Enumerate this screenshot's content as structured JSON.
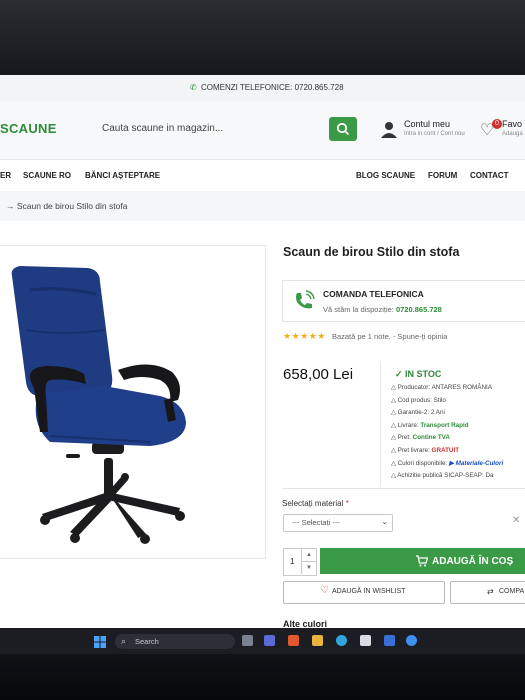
{
  "topbar": {
    "phone_text": "COMENZI TELEFONICE: 0720.865.728"
  },
  "header": {
    "logo": "SCAUNE",
    "search_placeholder": "Cauta scaune in magazin...",
    "account_label": "Contul meu",
    "account_sub": "Intra in cont / Cont nou",
    "fav_label": "Favo",
    "fav_sub": "Adauga",
    "fav_count": "0"
  },
  "nav": {
    "left": [
      "ER",
      "SCAUNE RO",
      "BĂNCI AȘTEPTARE"
    ],
    "right": [
      "BLOG SCAUNE",
      "FORUM",
      "CONTACT"
    ]
  },
  "breadcrumb": "→ Scaun de birou Stilo din stofa",
  "product": {
    "title": "Scaun de birou Stilo din stofa",
    "call_title": "COMANDA TELEFONICA",
    "call_sub": "Vă stăm la dispoziție:",
    "call_phone": "0720.865.728",
    "rating_stars": 5,
    "rating_text": "Bazată pe 1 note.",
    "rating_sep": "-",
    "rating_link": "Spune-ți opinia",
    "price": "658,00 Lei",
    "stock": "IN STOC",
    "specs": [
      {
        "k": "Producator:",
        "v": "ANTARES ROMÂNIA",
        "style": "plain"
      },
      {
        "k": "Cod produs:",
        "v": "Stilo",
        "style": "plain"
      },
      {
        "k": "Garantie-2:",
        "v": "2 Ani",
        "style": "plain"
      },
      {
        "k": "Livrare:",
        "v": "Transport Rapid",
        "style": "green"
      },
      {
        "k": "Pret:",
        "v": "Contine TVA",
        "style": "green"
      },
      {
        "k": "Pret livrare:",
        "v": "GRATUIT",
        "style": "red"
      },
      {
        "k": "Culori disponibile:",
        "v": "▶ Materiale-Culori",
        "style": "blue"
      },
      {
        "k": "Achizitie publică SICAP-SEAP:",
        "v": "Da",
        "style": "plain"
      }
    ],
    "material_label": "Selectați material",
    "material_required": "*",
    "material_selected": "--- Selectați ---",
    "qty": "1",
    "add_to_cart": "ADAUGĂ ÎN COȘ",
    "wishlist": "ADAUGĂ IN WISHLIST",
    "compare": "COMPA",
    "other_colors": "Alte culori"
  },
  "taskbar": {
    "search": "Search"
  },
  "colors": {
    "accent": "#3a9a46",
    "chair_fabric": "#1f3b82",
    "badge_red": "#d32f2f"
  }
}
